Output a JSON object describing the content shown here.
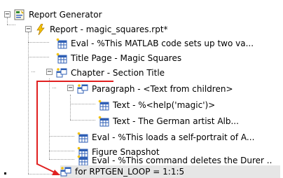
{
  "tree": {
    "root": {
      "label": "Report Generator",
      "icon": "report-generator-icon"
    },
    "report": {
      "label": "Report - magic_squares.rpt*",
      "icon": "lightning-icon"
    },
    "eval1": {
      "label": "Eval - %This MATLAB code sets up two va...",
      "icon": "table-component-icon"
    },
    "title_page": {
      "label": "Title Page - Magic Squares",
      "icon": "table-component-icon"
    },
    "chapter": {
      "label": "Chapter - Section Title",
      "icon": "chapter-icon"
    },
    "paragraph": {
      "label": "Paragraph - <Text from children>",
      "icon": "paragraph-icon"
    },
    "text1": {
      "label": "Text - %<help('magic')>",
      "icon": "table-component-icon"
    },
    "text2": {
      "label": "Text - The German artist Alb...",
      "icon": "table-component-icon"
    },
    "eval2": {
      "label": "Eval - %This loads a self-portrait of A...",
      "icon": "table-component-icon"
    },
    "figure": {
      "label": "Figure Snapshot",
      "icon": "table-component-icon"
    },
    "eval3": {
      "label": "Eval - %This command deletes the Durer ..",
      "icon": "table-component-icon"
    },
    "loop": {
      "label": "for RPTGEN_LOOP = 1:1:5",
      "icon": "loop-icon"
    }
  },
  "expanders": {
    "collapse_symbol": "−"
  },
  "colors": {
    "selection": "#e6e6e6",
    "drag_arrow": "#e02020",
    "tree_lines": "#9a9a9a"
  }
}
